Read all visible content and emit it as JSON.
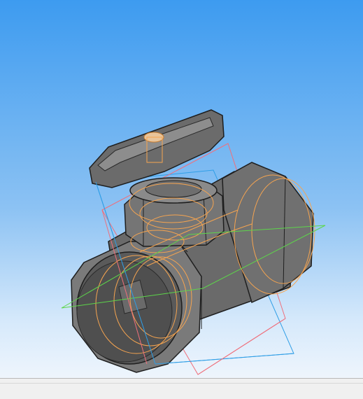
{
  "viewport": {
    "background_top": "#3d9bf0",
    "background_bottom": "#eef5fc",
    "model_name": "ball-valve-3d-model",
    "render_mode": "shaded-with-edges",
    "body_color": "#6b6b6b",
    "edge_color": "#1e1e1e",
    "hidden_lines_color": "#f5a450",
    "plane_colors": {
      "xy": "#5dd64a",
      "zy": "#2f9ee6",
      "zx": "#ef6f7b"
    }
  },
  "status_bar": {
    "text": ""
  }
}
